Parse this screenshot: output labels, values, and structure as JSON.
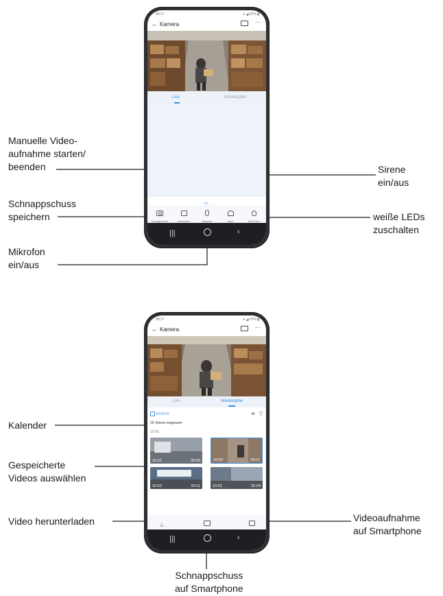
{
  "callouts": {
    "manual_video": "Manuelle Video-\naufnahme starten/\nbeenden",
    "schnappschuss_speichern": "Schnappschuss\nspeichern",
    "mikrofon": "Mikrofon\nein/aus",
    "sirene": "Sirene\nein/aus",
    "weisse_leds": "weiße LEDs\nzuschalten",
    "kalender": "Kalender",
    "gespeicherte_videos": "Gespeicherte\nVideos auswählen",
    "video_herunterladen": "Video herunterladen",
    "videoaufnahme_smartphone": "Videoaufnahme\nauf Smartphone",
    "schnappschuss_smartphone": "Schnappschuss\nauf Smartphone"
  },
  "phone1": {
    "status_time": "09:17",
    "status_right": "▾ ◢ 97% ▮",
    "title": "Kamera",
    "tab_live": "Live",
    "tab_wiedergabe": "Wiedergabe",
    "controls": [
      {
        "label": "Schnappschuss",
        "icon": "camera-icon"
      },
      {
        "label": "Aufnehmen",
        "icon": "video-icon"
      },
      {
        "label": "Sprechen",
        "icon": "microphone-icon"
      },
      {
        "label": "Alarm",
        "icon": "siren-icon"
      },
      {
        "label": "Weiß Licht",
        "icon": "bulb-icon"
      }
    ]
  },
  "phone2": {
    "status_time": "09:17",
    "status_right": "▾ ◢ 97% ▮",
    "title": "Kamera",
    "tab_live": "Live",
    "tab_wiedergabe": "Wiedergabe",
    "date": "2023/7/6",
    "count": "29 Videos insgesamt",
    "section_time": "10:00",
    "thumbs": [
      {
        "start": "10:52",
        "duration": "00:09"
      },
      {
        "start": "10:50",
        "duration": "00:11"
      },
      {
        "start": "10:52",
        "duration": "00:11"
      },
      {
        "start": "10:52",
        "duration": "00:04"
      }
    ],
    "controls": [
      {
        "label": "Herunterladen",
        "icon": "download-icon"
      },
      {
        "label": "Schnappschuss",
        "icon": "camera-icon"
      },
      {
        "label": "Aufnehmen",
        "icon": "video-icon"
      }
    ]
  },
  "colors": {
    "accent": "#3a8ee6",
    "phone_frame": "#2f3033",
    "callout_line": "#1a1a1a"
  }
}
